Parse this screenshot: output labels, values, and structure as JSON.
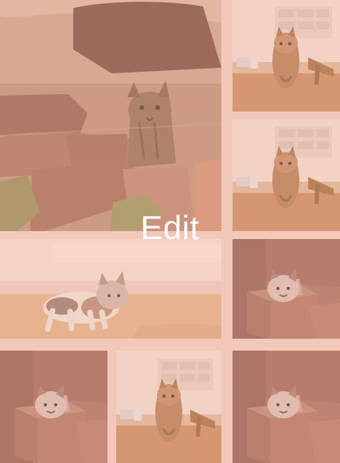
{
  "overlay": {
    "label": "Edit"
  },
  "colors": {
    "background": "#f1c8b9",
    "tint": "#f6b29b",
    "text": "#ffffff"
  },
  "tiles": [
    {
      "kind": "photo",
      "subject": "kitten-on-wood"
    },
    {
      "kind": "photo",
      "subject": "cat-on-table"
    },
    {
      "kind": "photo",
      "subject": "cat-on-table"
    },
    {
      "kind": "photo",
      "subject": "kitten-on-floor"
    },
    {
      "kind": "photo",
      "subject": "cat-in-box"
    },
    {
      "kind": "photo",
      "subject": "cat-in-box"
    },
    {
      "kind": "photo",
      "subject": "cat-on-table"
    },
    {
      "kind": "photo",
      "subject": "cat-in-box"
    }
  ]
}
